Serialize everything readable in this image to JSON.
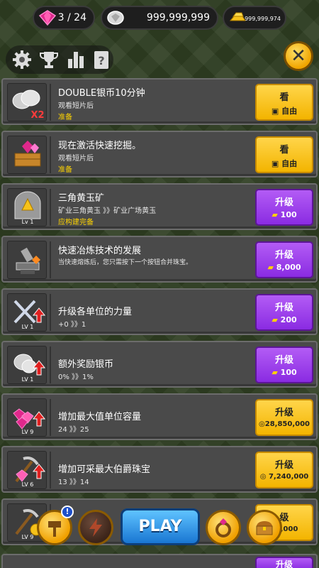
{
  "currency": {
    "gems": "3 / 24",
    "silver": "999,999,999",
    "gold": "999,999,974"
  },
  "toolbar": {
    "icons": [
      "settings-gear-icon",
      "trophy-icon",
      "stats-bars-icon",
      "help-card-icon"
    ],
    "close_label": "✕"
  },
  "rows": [
    {
      "title": "DOUBLE银币10分钟",
      "sub": "观看短片后",
      "note": "准备",
      "lv": "",
      "button": {
        "style": "gold",
        "label": "看",
        "sub": "自由"
      }
    },
    {
      "title": "现在激活快速挖掘。",
      "sub": "观看短片后",
      "note": "准备",
      "lv": "",
      "button": {
        "style": "gold",
        "label": "看",
        "sub": "自由"
      }
    },
    {
      "title": "三角黄玉矿",
      "sub": "矿业三角黄玉 》》矿业广场黄玉",
      "note": "应构建完备",
      "lv": "Lv 1",
      "button": {
        "style": "purple",
        "label": "升级",
        "sub": "100"
      }
    },
    {
      "title": "快速冶炼技术的发展",
      "sub": "当快速熔炼后，您只需按下一个按钮合并珠宝。",
      "note": "",
      "lv": "",
      "button": {
        "style": "purple",
        "label": "升级",
        "sub": "8,000"
      }
    },
    {
      "title": "升级各单位的力量",
      "sub": "+0 》》1",
      "note": "",
      "lv": "LV 1",
      "button": {
        "style": "purple",
        "label": "升级",
        "sub": "200"
      }
    },
    {
      "title": "额外奖励银币",
      "sub": "0% 》》1%",
      "note": "",
      "lv": "LV 1",
      "button": {
        "style": "purple",
        "label": "升级",
        "sub": "100"
      }
    },
    {
      "title": "增加最大值单位容量",
      "sub": "24 》》25",
      "note": "",
      "lv": "LV 9",
      "button": {
        "style": "gold",
        "label": "升级",
        "sub": "28,850,000"
      }
    },
    {
      "title": "增加可采最大伯爵珠宝",
      "sub": "13 》》14",
      "note": "",
      "lv": "LV 6",
      "button": {
        "style": "gold",
        "label": "升级",
        "sub": "7,240,000"
      }
    },
    {
      "title": "",
      "sub": "",
      "note": "",
      "lv": "LV 9",
      "button": {
        "style": "gold",
        "label": "级",
        "sub": "20,000"
      }
    }
  ],
  "dock": {
    "play_label": "PLAY",
    "alert_badge": "!",
    "items": [
      "hammer-icon",
      "lightning-icon",
      "ring-icon",
      "treasure-chest-icon"
    ]
  },
  "peek_button_label": "升级",
  "colors": {
    "gold_button": "#f3b400",
    "purple_button": "#8a2be2",
    "note_yellow": "#ffd400",
    "play_blue": "#1976d2"
  }
}
